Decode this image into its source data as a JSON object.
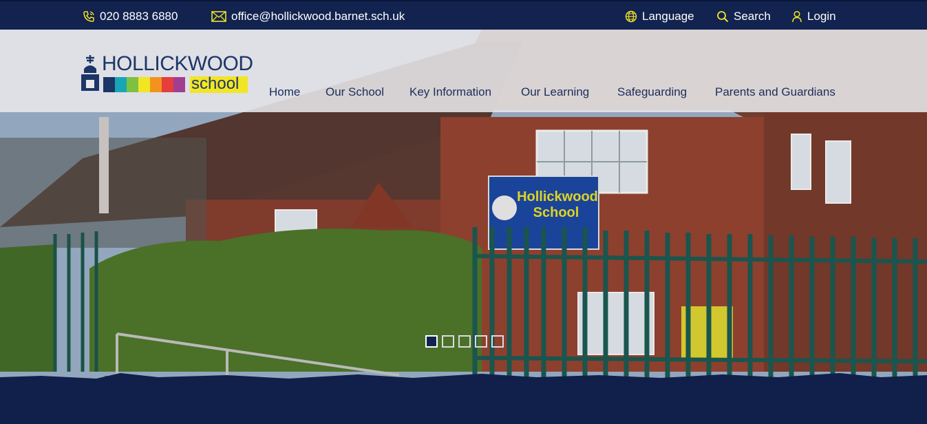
{
  "topbar": {
    "phone": "020 8883 6880",
    "email": "office@hollickwood.barnet.sch.uk",
    "language": "Language",
    "search": "Search",
    "login": "Login"
  },
  "logo": {
    "name": "HOLLICKWOOD",
    "school": "school",
    "strip_colors": [
      "#1d3567",
      "#18a5b5",
      "#7dc142",
      "#f2e524",
      "#f3931d",
      "#e63d3d",
      "#a23e8f"
    ]
  },
  "nav": [
    "Home",
    "Our School",
    "Key Information",
    "Our Learning",
    "Safeguarding",
    "Parents and Guardians"
  ],
  "hero": {
    "sign_line1": "Hollickwood",
    "sign_line2": "School",
    "slides_total": 5,
    "active_slide": 1
  },
  "colors": {
    "navy": "#12234f",
    "icon_yellow": "#f2e524",
    "nav_text": "#1b2d5a"
  }
}
